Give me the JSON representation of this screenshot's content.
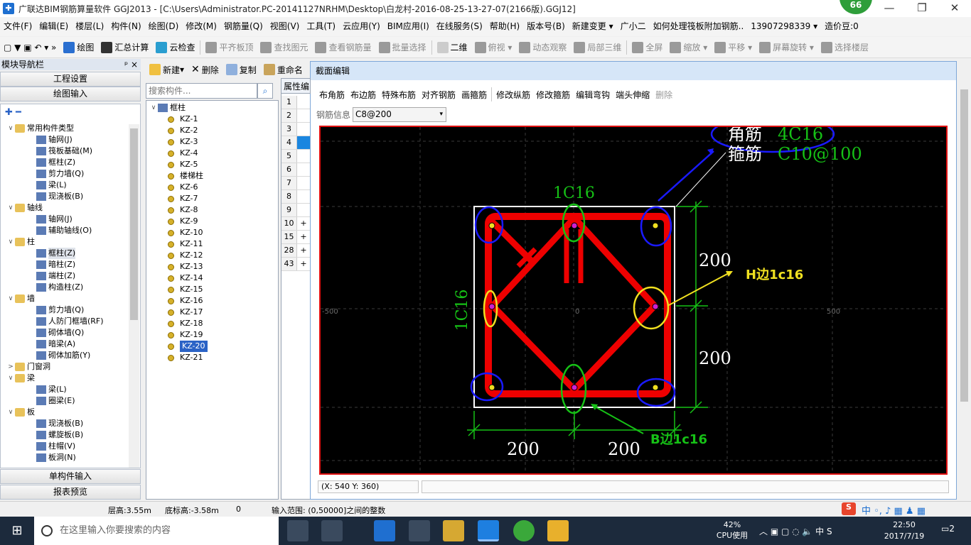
{
  "title": {
    "text": "广联达BIM钢筋算量软件 GGJ2013 - [C:\\Users\\Administrator.PC-20141127NRHM\\Desktop\\白龙村-2016-08-25-13-27-07(2166版).GGJ12]",
    "badge": "66"
  },
  "menu": [
    "文件(F)",
    "编辑(E)",
    "楼层(L)",
    "构件(N)",
    "绘图(D)",
    "修改(M)",
    "钢筋量(Q)",
    "视图(V)",
    "工具(T)",
    "云应用(Y)",
    "BIM应用(I)",
    "在线服务(S)",
    "帮助(H)",
    "版本号(B)",
    "新建变更 ▾",
    "广小二",
    "如何处理筏板附加钢筋..",
    "13907298339 ▾",
    "造价豆:0"
  ],
  "toolbar": [
    "绘图",
    "汇总计算",
    "云检查",
    "平齐板顶",
    "查找图元",
    "查看钢筋量",
    "批量选择",
    "二维",
    "俯视 ▾",
    "动态观察",
    "局部三维",
    "全屏",
    "缩放 ▾",
    "平移 ▾",
    "屏幕旋转 ▾",
    "选择楼层"
  ],
  "nav": {
    "header": "模块导航栏",
    "pin": "ᵖ ×",
    "btn1": "工程设置",
    "btn2": "绘图输入",
    "btn3": "单构件输入",
    "btn4": "报表预览",
    "tree": [
      {
        "t": "常用构件类型",
        "l": 0,
        "o": "∨"
      },
      {
        "t": "轴网(J)",
        "l": 1
      },
      {
        "t": "筏板基础(M)",
        "l": 1
      },
      {
        "t": "框柱(Z)",
        "l": 1
      },
      {
        "t": "剪力墙(Q)",
        "l": 1
      },
      {
        "t": "梁(L)",
        "l": 1
      },
      {
        "t": "现浇板(B)",
        "l": 1
      },
      {
        "t": "轴线",
        "l": 0,
        "o": "∨"
      },
      {
        "t": "轴网(J)",
        "l": 1
      },
      {
        "t": "辅助轴线(O)",
        "l": 1
      },
      {
        "t": "柱",
        "l": 0,
        "o": "∨"
      },
      {
        "t": "框柱(Z)",
        "l": 1
      },
      {
        "t": "暗柱(Z)",
        "l": 1
      },
      {
        "t": "端柱(Z)",
        "l": 1
      },
      {
        "t": "构造柱(Z)",
        "l": 1
      },
      {
        "t": "墙",
        "l": 0,
        "o": "∨"
      },
      {
        "t": "剪力墙(Q)",
        "l": 1
      },
      {
        "t": "人防门框墙(RF)",
        "l": 1
      },
      {
        "t": "砌体墙(Q)",
        "l": 1
      },
      {
        "t": "暗梁(A)",
        "l": 1
      },
      {
        "t": "砌体加筋(Y)",
        "l": 1
      },
      {
        "t": "门窗洞",
        "l": 0,
        "o": ">"
      },
      {
        "t": "梁",
        "l": 0,
        "o": "∨"
      },
      {
        "t": "梁(L)",
        "l": 1
      },
      {
        "t": "圈梁(E)",
        "l": 1
      },
      {
        "t": "板",
        "l": 0,
        "o": "∨"
      },
      {
        "t": "现浇板(B)",
        "l": 1
      },
      {
        "t": "螺旋板(B)",
        "l": 1
      },
      {
        "t": "柱帽(V)",
        "l": 1
      },
      {
        "t": "板洞(N)",
        "l": 1
      }
    ]
  },
  "col2": {
    "new": "新建",
    "del": "删除",
    "copy": "复制",
    "rename": "重命名",
    "search_placeholder": "搜索构件...",
    "root": "框柱",
    "items": [
      "KZ-1",
      "KZ-2",
      "KZ-3",
      "KZ-4",
      "KZ-5",
      "楼梯柱",
      "KZ-6",
      "KZ-7",
      "KZ-8",
      "KZ-9",
      "KZ-10",
      "KZ-11",
      "KZ-12",
      "KZ-13",
      "KZ-14",
      "KZ-15",
      "KZ-16",
      "KZ-17",
      "KZ-18",
      "KZ-19",
      "KZ-20",
      "KZ-21"
    ],
    "selected": "KZ-20"
  },
  "props": {
    "header": "属性编",
    "rows": [
      "1",
      "2",
      "3",
      "4",
      "5",
      "6",
      "7",
      "8",
      "9",
      "10",
      "15",
      "28",
      "43"
    ]
  },
  "dialog": {
    "title": "截面编辑",
    "tools": [
      "布角筋",
      "布边筋",
      "特殊布筋",
      "对齐钢筋",
      "画箍筋",
      "修改纵筋",
      "修改箍筋",
      "编辑弯钩",
      "端头伸缩",
      "删除"
    ],
    "info_label": "钢筋信息",
    "info_value": "C8@200",
    "coords": "(X: 540 Y: 360)"
  },
  "drawing": {
    "corner_label": "角筋",
    "corner_value": "4C16",
    "stirrup_label": "箍筋",
    "stirrup_value": "C10@100",
    "top_label": "1C16",
    "left_label": "1C16",
    "dim_right_1": "200",
    "dim_right_2": "200",
    "dim_bottom_1": "200",
    "dim_bottom_2": "200",
    "note_h": "H边1c16",
    "note_b": "B边1c16",
    "axis_left": "-500",
    "axis_mid": "0",
    "axis_right": "500"
  },
  "status": {
    "floor_h": "层高:3.55m",
    "bottom_h": "底标高:-3.58m",
    "zero": "0",
    "range": "输入范围: (0,50000]之间的整数"
  },
  "taskbar": {
    "search": "在这里输入你要搜索的内容",
    "cpu": "42%",
    "cpu_label": "CPU使用",
    "time": "22:50",
    "date": "2017/7/19",
    "ime": "中",
    "notif": "2"
  }
}
